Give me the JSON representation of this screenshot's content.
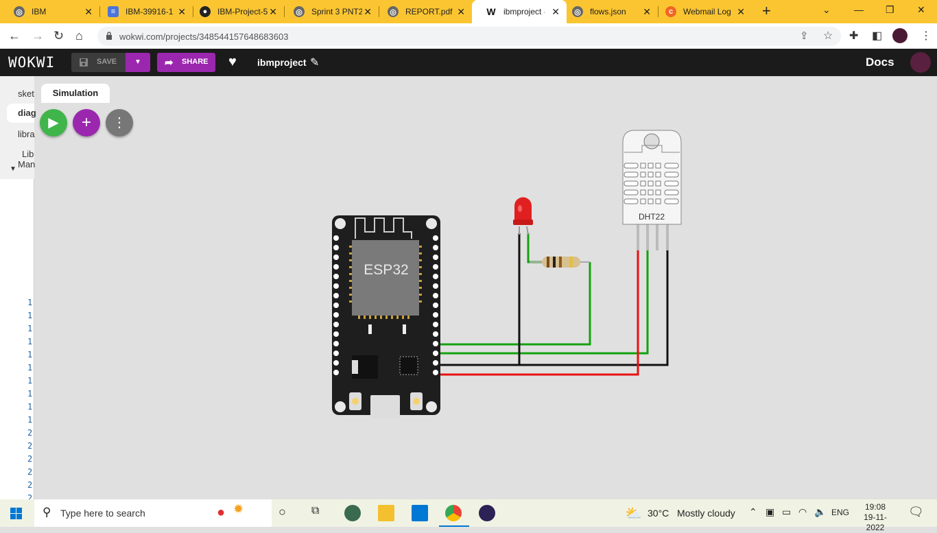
{
  "browser": {
    "tabs": [
      {
        "label": "IBM",
        "icon": "globe-icon",
        "active": false
      },
      {
        "label": "IBM-39916-1",
        "icon": "document-icon",
        "active": false
      },
      {
        "label": "IBM-Project-5",
        "icon": "github-icon",
        "active": false
      },
      {
        "label": "Sprint 3 PNT2",
        "icon": "globe-icon",
        "active": false
      },
      {
        "label": "REPORT.pdf",
        "icon": "globe-icon",
        "active": false
      },
      {
        "label": "ibmproject - W",
        "icon": "wokwi-icon",
        "active": true
      },
      {
        "label": "flows.json",
        "icon": "globe-icon",
        "active": false
      },
      {
        "label": "Webmail Log",
        "icon": "cpanel-icon",
        "active": false
      }
    ],
    "url": "wokwi.com/projects/348544157648683603"
  },
  "wokwi": {
    "logo": "WOKWI",
    "save_label": "SAVE",
    "share_label": "SHARE",
    "project_name": "ibmproject",
    "docs_label": "Docs",
    "sidebar_items": [
      "sket",
      "diag",
      "libra",
      "Lib",
      "Man"
    ],
    "line_numbers": [
      "1",
      "1",
      "1",
      "1",
      "1",
      "1",
      "1",
      "1",
      "1",
      "1",
      "2",
      "2",
      "2",
      "2",
      "2",
      "2"
    ],
    "sim_tab": "Simulation"
  },
  "diagram": {
    "esp32_label": "ESP32",
    "dht_label": "DHT22",
    "colors": {
      "wire_green": "#13a10e",
      "wire_red": "#e81010",
      "wire_black": "#111111",
      "board": "#1e1e1e",
      "led": "#e02020"
    }
  },
  "taskbar": {
    "search_placeholder": "Type here to search",
    "weather_temp": "30°C",
    "weather_desc": "Mostly cloudy",
    "lang": "ENG",
    "time": "19:08",
    "date": "19-11-2022"
  }
}
